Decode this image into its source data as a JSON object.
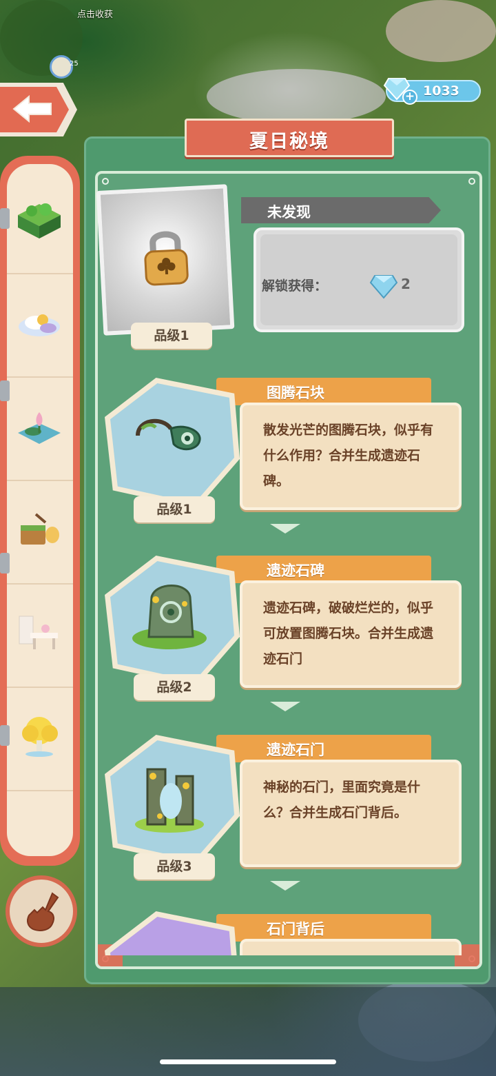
{
  "hud": {
    "collect_hint": "点击收获",
    "timer_badge": "25",
    "gem_count": "1033"
  },
  "panel": {
    "title": "夏日秘境"
  },
  "locked_item": {
    "status": "未发现",
    "reward_label": "解锁获得：",
    "reward_amount": "2",
    "grade": "品级1"
  },
  "items": [
    {
      "name": "图腾石块",
      "description": "散发光芒的图腾石块，似乎有什么作用？合并生成遗迹石碑。",
      "grade": "品级1"
    },
    {
      "name": "遗迹石碑",
      "description": "遗迹石碑，破破烂烂的，似乎可放置图腾石块。合并生成遗迹石门",
      "grade": "品级2"
    },
    {
      "name": "遗迹石门",
      "description": "神秘的石门，里面究竟是什么？合并生成石门背后。",
      "grade": "品级3"
    },
    {
      "name": "石门背后"
    }
  ],
  "sidebar": {
    "categories": [
      {
        "icon": "clover-garden-icon"
      },
      {
        "icon": "cloud-island-icon"
      },
      {
        "icon": "lotus-pond-icon"
      },
      {
        "icon": "picnic-basket-icon"
      },
      {
        "icon": "wedding-table-icon"
      },
      {
        "icon": "golden-tree-icon"
      }
    ]
  },
  "colors": {
    "accent_red": "#e46d56",
    "panel_green": "#4f9a6e",
    "tab_orange": "#eda249",
    "gem_blue": "#6cc6ea"
  }
}
